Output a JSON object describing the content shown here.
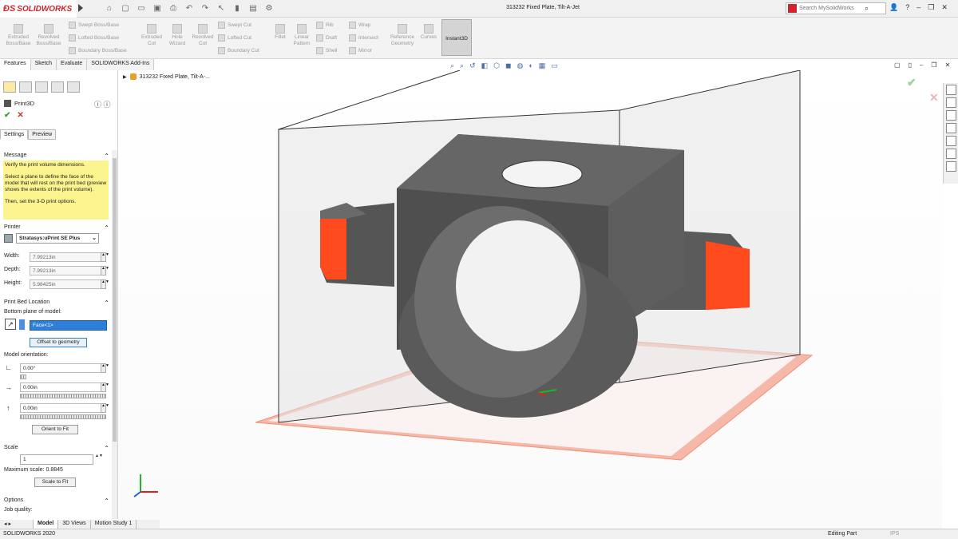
{
  "app": {
    "logo_text": "SOLIDWORKS",
    "document_title": "313232 Fixed Plate, Tilt-A-Jet",
    "search_placeholder": "Search MySolidWorks",
    "help_label": "?"
  },
  "ribbon": {
    "extruded_boss": "Extruded Boss/Base",
    "revolved_boss": "Revolved Boss/Base",
    "swept_boss": "Swept Boss/Base",
    "lofted_boss": "Lofted Boss/Base",
    "boundary_boss": "Boundary Boss/Base",
    "extruded_cut": "Extruded Cut",
    "hole_wizard": "Hole Wizard",
    "revolved_cut": "Revolved Cut",
    "swept_cut": "Swept Cut",
    "lofted_cut": "Lofted Cut",
    "boundary_cut": "Boundary Cut",
    "fillet": "Fillet",
    "linear_pattern": "Linear Pattern",
    "rib": "Rib",
    "draft": "Draft",
    "shell": "Shell",
    "wrap": "Wrap",
    "intersect": "Intersect",
    "mirror": "Mirror",
    "reference_geometry": "Reference Geometry",
    "curves": "Curves",
    "instant3d": "Instant3D"
  },
  "command_tabs": [
    "Features",
    "Sketch",
    "Evaluate",
    "SOLIDWORKS Add-Ins"
  ],
  "property_manager": {
    "title": "Print3D",
    "subtabs": [
      "Settings",
      "Preview"
    ],
    "message_header": "Message",
    "message_lines": [
      "Verify the print volume dimensions.",
      "Select a plane to define the face of the model that will rest on the print bed (preview shows the extents of the print volume).",
      "Then, set the 3-D print options."
    ],
    "printer_header": "Printer",
    "printer_value": "Stratasys:uPrint SE Plus",
    "width_label": "Width:",
    "width_value": "7.99213in",
    "depth_label": "Depth:",
    "depth_value": "7.99213in",
    "height_label": "Height:",
    "height_value": "5.98425in",
    "bed_header": "Print Bed Location",
    "bottom_plane_label": "Bottom plane of model:",
    "face_value": "Face<1>",
    "offset_button": "Offset to geometry",
    "orientation_label": "Model orientation:",
    "rotation_value": "0.00°",
    "x_offset_value": "0.00in",
    "y_offset_value": "0.00in",
    "orient_button": "Orient to Fit",
    "scale_header": "Scale",
    "scale_value": "1",
    "max_scale": "Maximum scale: 0.8845",
    "scale_button": "Scale to Fit",
    "options_header": "Options",
    "job_quality_label": "Job quality:"
  },
  "viewport": {
    "tree_node": "313232 Fixed Plate, Tilt-A-..."
  },
  "bottom_tabs": [
    "Model",
    "3D Views",
    "Motion Study 1"
  ],
  "status": {
    "version": "SOLIDWORKS 2020",
    "mode": "Editing Part",
    "units": "IPS"
  },
  "colors": {
    "brand": "#d2232a",
    "selection_blue": "#2f7fd8",
    "message_yellow": "#fcf48f",
    "print_bed": "#f6b8a8",
    "part_gray": "#5c5c5c",
    "overhang_orange": "#ff4a1e"
  }
}
